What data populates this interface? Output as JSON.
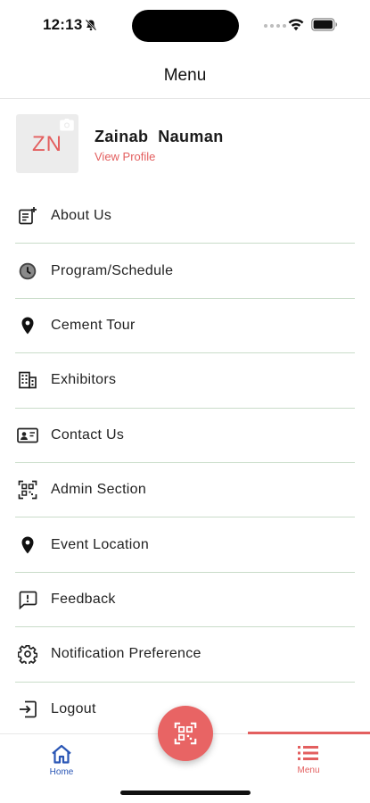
{
  "status_bar": {
    "time": "12:13",
    "icons": [
      "bell-slash-icon",
      "signal-dots-icon",
      "wifi-icon",
      "battery-icon"
    ]
  },
  "header": {
    "title": "Menu"
  },
  "profile": {
    "initials": "ZN",
    "name": "Zainab  Nauman",
    "link": "View Profile",
    "avatar_icon": "camera-icon"
  },
  "menu": {
    "items": [
      {
        "label": "About Us",
        "icon": "about-document-icon"
      },
      {
        "label": "Program/Schedule",
        "icon": "clock-icon"
      },
      {
        "label": "Cement Tour",
        "icon": "location-pin-icon"
      },
      {
        "label": "Exhibitors",
        "icon": "building-icon"
      },
      {
        "label": "Contact Us",
        "icon": "contact-card-icon"
      },
      {
        "label": "Admin Section",
        "icon": "qr-scan-icon"
      },
      {
        "label": "Event Location",
        "icon": "location-pin-icon"
      },
      {
        "label": "Feedback",
        "icon": "feedback-icon"
      },
      {
        "label": "Notification Preference",
        "icon": "gear-icon"
      },
      {
        "label": "Logout",
        "icon": "logout-icon"
      }
    ]
  },
  "bottom_nav": {
    "home_label": "Home",
    "menu_label": "Menu",
    "fab_icon": "qr-scan-icon"
  },
  "colors": {
    "accent": "#e35f5f",
    "home_tab": "#2a56b5",
    "divider": "#c9dcc9"
  }
}
